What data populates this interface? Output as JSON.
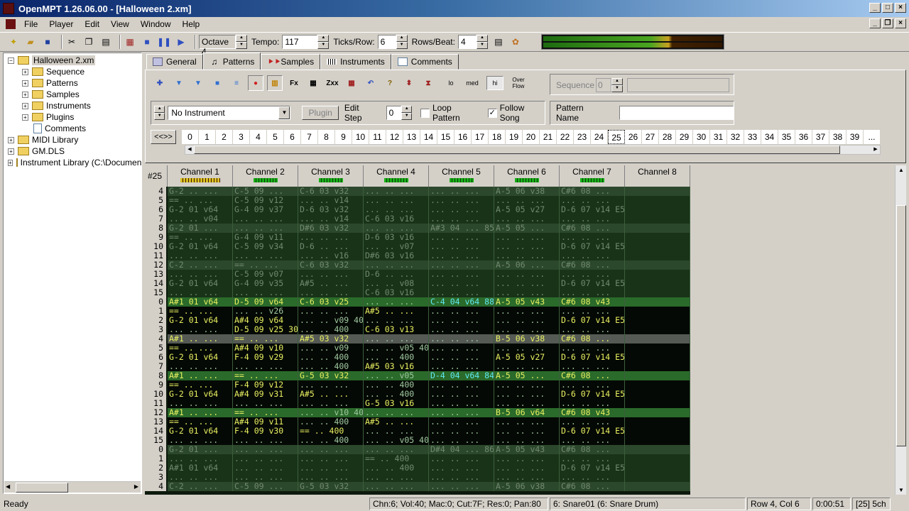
{
  "window": {
    "title": "OpenMPT 1.26.06.00 - [Halloween 2.xm]"
  },
  "menu": [
    "File",
    "Player",
    "Edit",
    "View",
    "Window",
    "Help"
  ],
  "toolbar": {
    "octave": "Octave 4",
    "tempo_label": "Tempo:",
    "tempo": "117",
    "ticks_label": "Ticks/Row:",
    "ticks": "6",
    "rows_label": "Rows/Beat:",
    "rows": "4"
  },
  "tree": {
    "root": "Halloween 2.xm",
    "children": [
      "Sequence",
      "Patterns",
      "Samples",
      "Instruments",
      "Plugins",
      "Comments"
    ],
    "others": [
      "MIDI Library",
      "GM.DLS",
      "Instrument Library (C:\\Documen"
    ]
  },
  "tabs": [
    "General",
    "Patterns",
    "Samples",
    "Instruments",
    "Comments"
  ],
  "pattern_ctrl": {
    "quality": [
      "lo",
      "med",
      "hi",
      "Over Flow"
    ],
    "sequence_label": "Sequence",
    "sequence_value": "0",
    "instrument": "No Instrument",
    "plugin_btn": "Plugin",
    "edit_step_label": "Edit Step",
    "edit_step": "0",
    "loop_pattern": "Loop Pattern",
    "follow_song": "Follow Song",
    "pattern_name_label": "Pattern Name",
    "nav": "<<>>",
    "orders": [
      "0",
      "1",
      "2",
      "3",
      "4",
      "5",
      "6",
      "7",
      "8",
      "9",
      "10",
      "11",
      "12",
      "13",
      "14",
      "15",
      "16",
      "17",
      "18",
      "19",
      "20",
      "21",
      "22",
      "23",
      "24",
      "25",
      "26",
      "27",
      "28",
      "29",
      "30",
      "31",
      "32",
      "33",
      "34",
      "35",
      "36",
      "37",
      "38",
      "39",
      "..."
    ],
    "current_order": "25"
  },
  "pattern": {
    "number": "#25",
    "channels": [
      "Channel 1",
      "Channel 2",
      "Channel 3",
      "Channel 4",
      "Channel 5",
      "Channel 6",
      "Channel 7",
      "Channel 8"
    ],
    "prev_rows": [
      {
        "n": "4",
        "c": [
          "G-2 .. ...",
          "C-5 09 ...",
          "C-6 03 v32",
          "... .. ...",
          "... .. ...",
          "A-5 06 v38",
          "C#6 08 ...",
          ""
        ]
      },
      {
        "n": "5",
        "c": [
          "== .. ...",
          "C-5 09 v12",
          "... .. v14",
          "... .. ...",
          "... .. ...",
          "... .. ...",
          "... .. ...",
          ""
        ]
      },
      {
        "n": "6",
        "c": [
          "G-2 01 v64",
          "G-4 09 v37",
          "D-6 03 v32",
          "... .. ...",
          "... .. ...",
          "A-5 05 v27",
          "D-6 07 v14 E56",
          ""
        ]
      },
      {
        "n": "7",
        "c": [
          "... .. v04",
          "... .. ...",
          "... .. v14",
          "C-6 03 v16",
          "... .. ...",
          "... .. ...",
          "... .. ...",
          ""
        ]
      },
      {
        "n": "8",
        "c": [
          "G-2 01 ...",
          "... .. ...",
          "D#6 03 v32",
          "... .. ...",
          "A#3 04 ... 856",
          "A-5 05 ...",
          "C#6 08 ...",
          ""
        ]
      },
      {
        "n": "9",
        "c": [
          "== .. ...",
          "G-4 09 v11",
          "... .. ...",
          "D-6 03 v16",
          "... .. ...",
          "... .. ...",
          "... .. ...",
          ""
        ]
      },
      {
        "n": "10",
        "c": [
          "G-2 01 v64",
          "C-5 09 v34",
          "D-6 .. ...",
          "... .. v07",
          "... .. ...",
          "... .. ...",
          "D-6 07 v14 E56",
          ""
        ]
      },
      {
        "n": "11",
        "c": [
          "... .. ...",
          "... .. ...",
          "... .. v16",
          "D#6 03 v16",
          "... .. ...",
          "... .. ...",
          "... .. ...",
          ""
        ]
      },
      {
        "n": "12",
        "c": [
          "C-2 .. ...",
          "== .. ...",
          "C-6 03 v32",
          "... .. ...",
          "... .. ...",
          "A-5 06 ...",
          "C#6 08 ...",
          ""
        ]
      },
      {
        "n": "13",
        "c": [
          "... .. ...",
          "C-5 09 v07",
          "... .. ...",
          "D-6 .. ...",
          "... .. ...",
          "... .. ...",
          "... .. ...",
          ""
        ]
      },
      {
        "n": "14",
        "c": [
          "G-2 01 v64",
          "G-4 09 v35",
          "A#5 .. ...",
          "... .. v08",
          "... .. ...",
          "... .. ...",
          "D-6 07 v14 E56",
          ""
        ]
      },
      {
        "n": "15",
        "c": [
          "... .. ...",
          "... .. ...",
          "... .. ...",
          "C-6 03 v16",
          "... .. ...",
          "... .. ...",
          "... .. ...",
          ""
        ]
      }
    ],
    "rows": [
      {
        "n": "0",
        "c": [
          "A#1 01 v64",
          "D-5 09 v64",
          "C-6 03 v25",
          "... .. ...",
          "C-4 04 v64 88F",
          "A-5 05 v43",
          "C#6 08 v43",
          ""
        ]
      },
      {
        "n": "1",
        "c": [
          "== .. ...",
          "... .. v26",
          "... .. ...",
          "A#5 .. ...",
          "... .. ...",
          "... .. ...",
          "... .. ...",
          ""
        ]
      },
      {
        "n": "2",
        "c": [
          "G-2 01 v64",
          "A#4 09 v64",
          "... .. v09 400",
          "... .. ...",
          "... .. ...",
          "... .. ...",
          "D-6 07 v14 E56",
          ""
        ]
      },
      {
        "n": "3",
        "c": [
          "... .. ...",
          "D-5 09 v25 300",
          "... .. 400",
          "C-6 03 v13",
          "... .. ...",
          "... .. ...",
          "... .. ...",
          ""
        ]
      },
      {
        "n": "4",
        "c": [
          "A#1 .. ...",
          "== .. ...",
          "A#5 03 v32",
          "... .. ...",
          "... .. ...",
          "B-5 06 v38",
          "C#6 08 ...",
          ""
        ]
      },
      {
        "n": "5",
        "c": [
          "== .. ...",
          "A#4 09 v10",
          "... .. v09",
          "... .. v05 400",
          "... .. ...",
          "... .. ...",
          "... .. ...",
          ""
        ]
      },
      {
        "n": "6",
        "c": [
          "G-2 01 v64",
          "F-4 09 v29",
          "... .. 400",
          "... .. 400",
          "... .. ...",
          "A-5 05 v27",
          "D-6 07 v14 E56",
          ""
        ]
      },
      {
        "n": "7",
        "c": [
          "... .. ...",
          "... .. ...",
          "... .. 400",
          "A#5 03 v16",
          "... .. ...",
          "... .. ...",
          "... .. ...",
          ""
        ]
      },
      {
        "n": "8",
        "c": [
          "A#1 .. ...",
          "== .. ...",
          "G-5 03 v32",
          "... .. v05",
          "D-4 04 v64 841",
          "A-5 05 ...",
          "C#6 08 ...",
          ""
        ]
      },
      {
        "n": "9",
        "c": [
          "== .. ...",
          "F-4 09 v12",
          "... .. ...",
          "... .. 400",
          "... .. ...",
          "... .. ...",
          "... .. ...",
          ""
        ]
      },
      {
        "n": "10",
        "c": [
          "G-2 01 v64",
          "A#4 09 v31",
          "A#5 .. ...",
          "... .. 400",
          "... .. ...",
          "... .. ...",
          "D-6 07 v14 E56",
          ""
        ]
      },
      {
        "n": "11",
        "c": [
          "... .. ...",
          "... .. ...",
          "... .. ...",
          "G-5 03 v16",
          "... .. ...",
          "... .. ...",
          "... .. ...",
          ""
        ]
      },
      {
        "n": "12",
        "c": [
          "A#1 .. ...",
          "== .. ...",
          "... .. v10 400",
          "... .. ...",
          "... .. ...",
          "B-5 06 v64",
          "C#6 08 v43",
          ""
        ]
      },
      {
        "n": "13",
        "c": [
          "== .. ...",
          "A#4 09 v11",
          "... .. 400",
          "A#5 .. ...",
          "... .. ...",
          "... .. ...",
          "... .. ...",
          ""
        ]
      },
      {
        "n": "14",
        "c": [
          "G-2 01 v64",
          "F-4 09 v30",
          "== .. 400",
          "... .. ...",
          "... .. ...",
          "... .. ...",
          "D-6 07 v14 E56",
          ""
        ]
      },
      {
        "n": "15",
        "c": [
          "... .. ...",
          "... .. ...",
          "... .. 400",
          "... .. v05 400",
          "... .. ...",
          "... .. ...",
          "... .. ...",
          ""
        ]
      }
    ],
    "next_rows": [
      {
        "n": "0",
        "c": [
          "G-2 01 ...",
          "... .. ...",
          "... .. ...",
          "... .. ...",
          "D#4 04 ... 868",
          "A-5 05 v43",
          "C#6 08 ...",
          ""
        ]
      },
      {
        "n": "1",
        "c": [
          "... .. ...",
          "... .. ...",
          "... .. ...",
          "== .. 400",
          "... .. ...",
          "... .. ...",
          "... .. ...",
          ""
        ]
      },
      {
        "n": "2",
        "c": [
          "A#1 01 v64",
          "... .. ...",
          "... .. ...",
          "... .. 400",
          "... .. ...",
          "... .. ...",
          "D-6 07 v14 E56",
          ""
        ]
      },
      {
        "n": "3",
        "c": [
          "... .. ...",
          "... .. ...",
          "... .. ...",
          "... .. ...",
          "... .. ...",
          "... .. ...",
          "... .. ...",
          ""
        ]
      },
      {
        "n": "4",
        "c": [
          "C-2 .. ...",
          "C-5 09 ...",
          "G-5 03 v32",
          "... .. ...",
          "... .. ...",
          "A-5 06 v38",
          "C#6 08 ...",
          ""
        ]
      }
    ],
    "cursor_row": "4"
  },
  "status": {
    "ready": "Ready",
    "info": "Chn:6; Vol:40; Mac:0; Cut:7F; Res:0; Pan:80",
    "instrument": "6: Snare01 (6: Snare Drum)",
    "position": "Row 4, Col 6",
    "time": "0:00:51",
    "pattern": "[25] 5ch"
  }
}
